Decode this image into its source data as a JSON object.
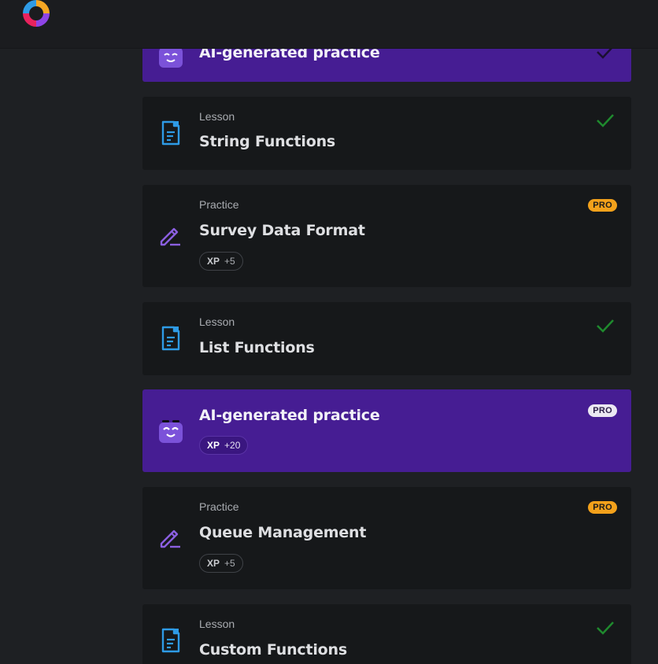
{
  "items": [
    {
      "type": "AI-generated practice",
      "title": "AI-generated practice",
      "status": "completed"
    },
    {
      "type_label": "Lesson",
      "title": "String Functions",
      "status": "completed"
    },
    {
      "type_label": "Practice",
      "title": "Survey Data Format",
      "xp_label": "XP",
      "xp_value": "+5",
      "badge": "PRO"
    },
    {
      "type_label": "Lesson",
      "title": "List Functions",
      "status": "completed"
    },
    {
      "title": "AI-generated practice",
      "xp_label": "XP",
      "xp_value": "+20",
      "badge": "PRO"
    },
    {
      "type_label": "Practice",
      "title": "Queue Management",
      "xp_label": "XP",
      "xp_value": "+5",
      "badge": "PRO"
    },
    {
      "type_label": "Lesson",
      "title": "Custom Functions",
      "status": "completed"
    }
  ],
  "colors": {
    "background": "#1e2023",
    "card": "#16181a",
    "ai_card": "#461d93",
    "lesson_icon": "#2e9be6",
    "practice_icon": "#8b5fe0",
    "check": "#1f8a2e",
    "pro_badge": "#f3a11b"
  },
  "icons": {
    "logo": "brand-logo",
    "lesson": "document-icon",
    "practice": "pencil-icon",
    "ai": "robot-mascot-icon",
    "done": "check-icon"
  }
}
